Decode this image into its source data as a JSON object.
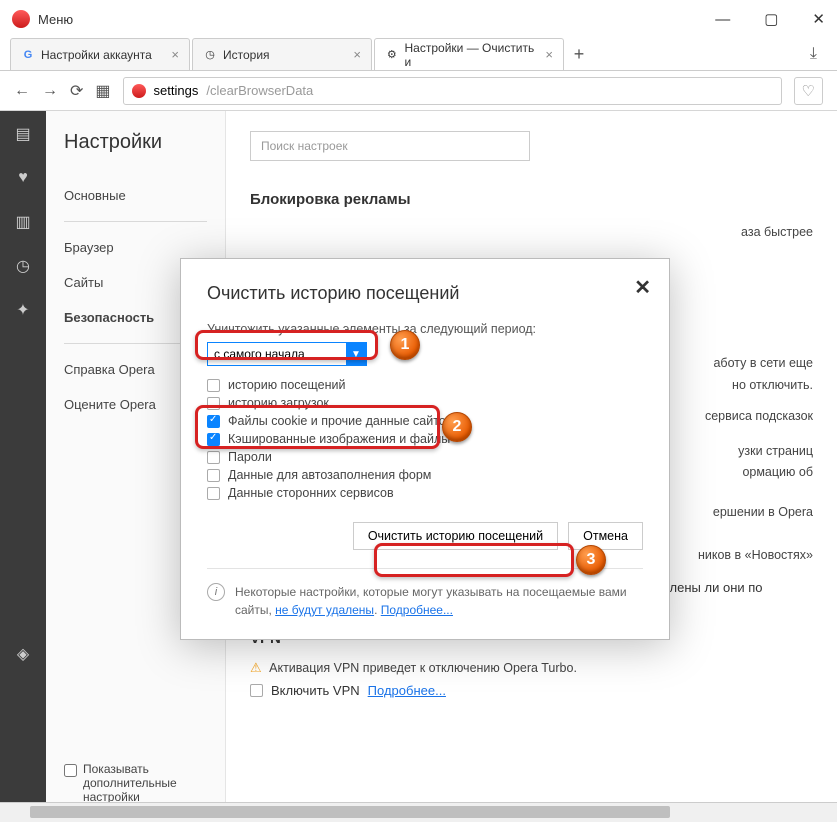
{
  "titlebar": {
    "menu": "Меню"
  },
  "win": {
    "min": "—",
    "max": "▢",
    "close": "✕"
  },
  "tabs": [
    {
      "icon": "G",
      "label": "Настройки аккаунта",
      "active": false
    },
    {
      "icon": "◷",
      "label": "История",
      "active": false
    },
    {
      "icon": "⚙",
      "label": "Настройки — Очистить и",
      "active": true
    }
  ],
  "address": {
    "prefix": "settings",
    "path": "/clearBrowserData"
  },
  "sidebar": {
    "title": "Настройки",
    "items": [
      "Основные",
      "Браузер",
      "Сайты",
      "Безопасность",
      "Справка Opera",
      "Оцените Opera"
    ],
    "extra_checkbox": "Показывать дополнительные настройки"
  },
  "content": {
    "search_placeholder": "Поиск настроек",
    "heading1": "Блокировка рекламы",
    "line_fast": "аза быстрее",
    "line_net1": "аботу в сети еще",
    "line_net2": "но отключить.",
    "line_hint": "сервиса подсказок",
    "line_pages1": "узки страниц",
    "line_pages2": "ормацию об",
    "line_opera": "ершении в Opera",
    "line_news": "ников в «Новостях»",
    "line_partner": "Разрешить партнерским поисковым системам проверять, установлены ли они по умолчанию",
    "vpn_head": "VPN",
    "vpn_warn": "Активация VPN приведет к отключению Opera Turbo.",
    "vpn_enable": "Включить VPN",
    "vpn_more": "Подробнее..."
  },
  "modal": {
    "title": "Очистить историю посещений",
    "subtitle": "Уничтожить указанные элементы за следующий период:",
    "period_value": "с самого начала",
    "options": [
      {
        "label": "историю посещений",
        "checked": false
      },
      {
        "label": "историю загрузок",
        "checked": false
      },
      {
        "label": "Файлы cookie и прочие данные сайтов",
        "checked": true
      },
      {
        "label": "Кэшированные изображения и файлы",
        "checked": true
      },
      {
        "label": "Пароли",
        "checked": false
      },
      {
        "label": "Данные для автозаполнения форм",
        "checked": false
      },
      {
        "label": "Данные сторонних сервисов",
        "checked": false
      }
    ],
    "action_clear": "Очистить историю посещений",
    "action_cancel": "Отмена",
    "note_text1": "Некоторые настройки, которые могут указывать на посещаемые вами сайты, ",
    "note_link1": "не будут удалены",
    "note_dot": ". ",
    "note_link2": "Подробнее..."
  },
  "callouts": {
    "n1": "1",
    "n2": "2",
    "n3": "3"
  }
}
